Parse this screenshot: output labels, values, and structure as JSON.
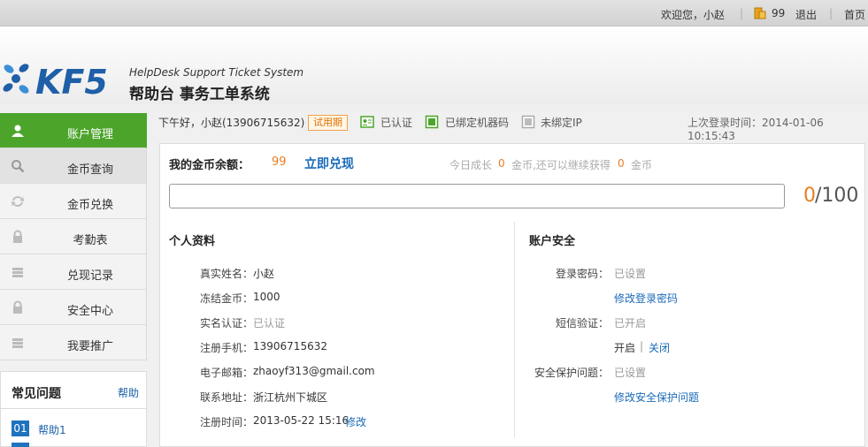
{
  "topbar": {
    "welcome": "欢迎您，小赵",
    "coins": "99",
    "logout": "退出",
    "home": "首页"
  },
  "logo": {
    "brand": "KF5",
    "tagline": "HelpDesk Support Ticket System",
    "title": "帮助台 事务工单系统"
  },
  "sidebar": {
    "items": [
      {
        "label": "账户管理",
        "icon": "user-icon"
      },
      {
        "label": "金币查询",
        "icon": "search-icon"
      },
      {
        "label": "金币兑换",
        "icon": "exchange-icon"
      },
      {
        "label": "考勤表",
        "icon": "lock-icon"
      },
      {
        "label": "兑现记录",
        "icon": "stack-icon"
      },
      {
        "label": "安全中心",
        "icon": "lock-icon"
      },
      {
        "label": "我要推广",
        "icon": "stack-icon"
      }
    ]
  },
  "faq": {
    "title": "常见问题",
    "help": "帮助",
    "items": [
      {
        "num": "01",
        "label": "帮助1"
      }
    ]
  },
  "status": {
    "greeting": "下午好，小赵(13906715632)",
    "trial": "试用期",
    "verified": "已认证",
    "machine": "已绑定机器码",
    "ip": "未绑定IP",
    "last_login": "上次登录时间：2014-01-06 10:15:43"
  },
  "balance": {
    "label": "我的金币余额：",
    "value": "99",
    "cash_link": "立即兑现",
    "growth_prefix": "今日成长",
    "growth_today": "0",
    "growth_mid": "金币,还可以继续获得",
    "growth_remain": "0",
    "growth_suffix": "金币",
    "progress_current": "0",
    "progress_max": "/100",
    "progress_fraction": 0
  },
  "profile": {
    "title": "个人资料",
    "fields": [
      {
        "label": "真实姓名：",
        "value": "小赵"
      },
      {
        "label": "冻结金币：",
        "value": "1000"
      },
      {
        "label": "实名认证：",
        "value": "已认证"
      },
      {
        "label": "注册手机：",
        "value": "13906715632"
      },
      {
        "label": "电子邮箱：",
        "value": "zhaoyf313@gmail.com"
      },
      {
        "label": "联系地址：",
        "value": "浙江杭州下城区"
      },
      {
        "label": "注册时间：",
        "value": "2013-05-22 15:16",
        "link": "修改"
      }
    ]
  },
  "security": {
    "title": "账户安全",
    "password_label": "登录密码：",
    "password_value": "已设置",
    "password_link": "修改登录密码",
    "sms_label": "短信验证：",
    "sms_value": "已开启",
    "sms_on": "开启",
    "sms_sep": "|",
    "sms_off": "关闭",
    "question_label": "安全保护问题：",
    "question_value": "已设置",
    "question_link": "修改安全保护问题"
  },
  "colors": {
    "accent_green": "#4ca52a",
    "link_blue": "#1a6bb8",
    "orange": "#e67e22"
  }
}
